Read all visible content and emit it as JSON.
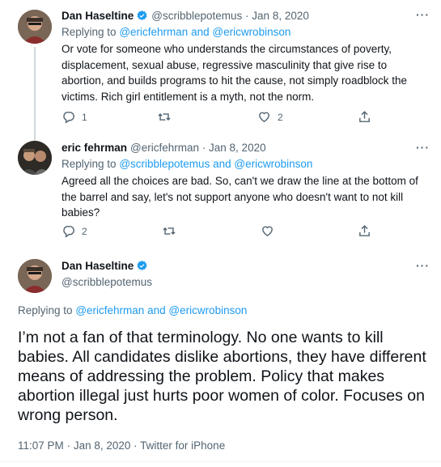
{
  "tweets": [
    {
      "name": "Dan Haseltine",
      "handle": "@scribblepotemus",
      "date": "Jan 8, 2020",
      "replying_label": "Replying to",
      "reply_mention_1": "@ericfehrman",
      "reply_and": "and",
      "reply_mention_2": "@ericwrobinson",
      "text": "Or vote for someone who understands the circumstances of poverty, displacement, sexual abuse, regressive masculinity that give rise to abortion, and builds programs to hit the cause, not simply roadblock the victims. Rich girl entitlement is a myth, not the norm.",
      "reply_count": "1",
      "retweet_count": "",
      "like_count": "2",
      "more": "···"
    },
    {
      "name": "eric fehrman",
      "handle": "@ericfehrman",
      "date": "Jan 8, 2020",
      "replying_label": "Replying to",
      "reply_mention_1": "@scribblepotemus",
      "reply_and": "and",
      "reply_mention_2": "@ericwrobinson",
      "text": "Agreed all the choices are bad.  So, can't we draw the line at the bottom of the barrel and say, let's not support anyone who doesn't want to not kill babies?",
      "reply_count": "2",
      "retweet_count": "",
      "like_count": "",
      "more": "···"
    }
  ],
  "main_tweet": {
    "name": "Dan Haseltine",
    "handle": "@scribblepotemus",
    "more": "···",
    "replying_label": "Replying to",
    "reply_mention_1": "@ericfehrman",
    "reply_and": "and",
    "reply_mention_2": "@ericwrobinson",
    "text": "I’m not a fan of that terminology.  No one wants to kill babies.  All candidates dislike abortions, they have different means of addressing the problem.  Policy that makes abortion illegal just hurts poor women of color.  Focuses on wrong person.",
    "time": "11:07 PM",
    "date": "Jan 8, 2020",
    "source": "Twitter for iPhone"
  },
  "icons": {
    "reply": "reply-icon",
    "retweet": "retweet-icon",
    "like": "heart-icon",
    "share": "share-icon",
    "verified": "verified-badge-icon"
  },
  "colors": {
    "link": "#1d9bf0",
    "muted": "#536471",
    "text": "#0f1419",
    "thread_line": "#cfd9de"
  }
}
